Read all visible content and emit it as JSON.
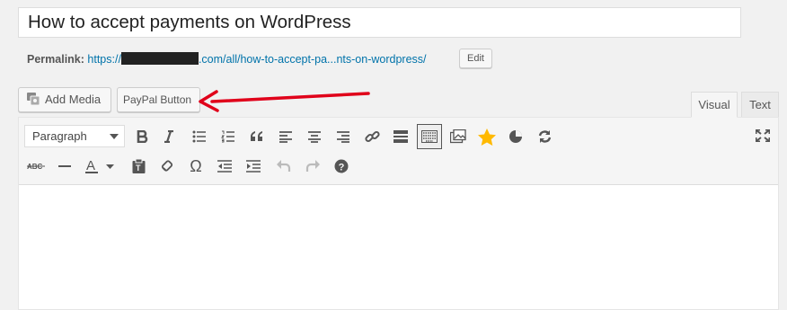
{
  "post": {
    "title": "How to accept payments on WordPress",
    "permalink_label": "Permalink:",
    "permalink_prefix": "https://",
    "permalink_suffix": ".com/all/how-to-accept-pa...nts-on-wordpress/",
    "edit_label": "Edit"
  },
  "media_buttons": {
    "add_media": "Add Media",
    "paypal": "PayPal Button"
  },
  "editor_tabs": {
    "visual": "Visual",
    "text": "Text"
  },
  "toolbar": {
    "format_value": "Paragraph",
    "row1": [
      "bold-icon",
      "italic-icon",
      "bullet-list-icon",
      "numbered-list-icon",
      "blockquote-icon",
      "align-left-icon",
      "align-center-icon",
      "align-right-icon",
      "link-icon",
      "read-more-icon",
      "toolbar-toggle-icon",
      "gallery-icon",
      "star-icon",
      "pie-chart-icon",
      "sync-icon"
    ],
    "row1_right": [
      "fullscreen-icon"
    ],
    "row2": [
      "strikethrough-icon",
      "horizontal-line-icon",
      "text-color-icon",
      "paste-text-icon",
      "clear-formatting-icon",
      "omega-icon",
      "outdent-icon",
      "indent-icon",
      "undo-icon",
      "redo-icon",
      "help-icon"
    ]
  },
  "colors": {
    "link": "#0073aa",
    "annotation_arrow": "#e0001a",
    "star": "#ffb900"
  }
}
